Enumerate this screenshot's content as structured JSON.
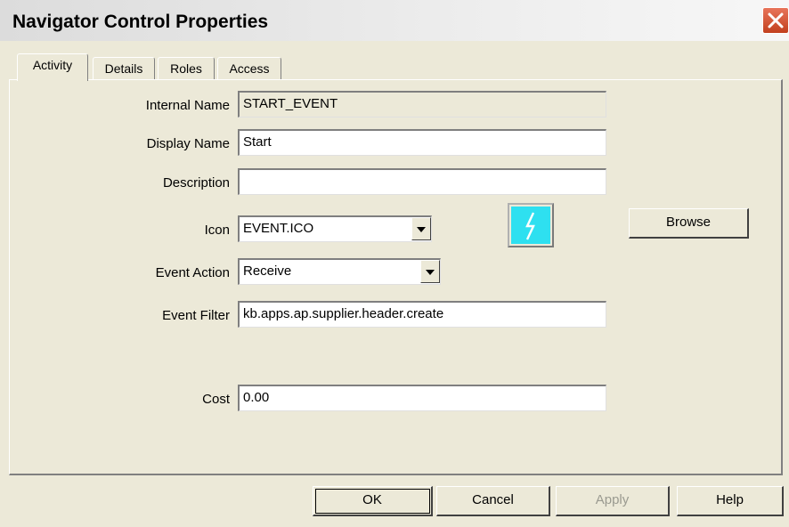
{
  "window": {
    "title": "Navigator Control Properties",
    "close_glyph": "✕"
  },
  "tabs": [
    {
      "label": "Activity",
      "active": true
    },
    {
      "label": "Details",
      "active": false
    },
    {
      "label": "Roles",
      "active": false
    },
    {
      "label": "Access",
      "active": false
    }
  ],
  "form": {
    "internal_name": {
      "label": "Internal Name",
      "value": "START_EVENT"
    },
    "display_name": {
      "label": "Display Name",
      "value": "Start"
    },
    "description": {
      "label": "Description",
      "value": ""
    },
    "icon": {
      "label": "Icon",
      "value": "EVENT.ICO",
      "preview_icon": "lightning-icon"
    },
    "event_action": {
      "label": "Event Action",
      "value": "Receive"
    },
    "event_filter": {
      "label": "Event Filter",
      "value": "kb.apps.ap.supplier.header.create"
    },
    "cost": {
      "label": "Cost",
      "value": "0.00"
    }
  },
  "buttons": {
    "browse": "Browse",
    "ok": "OK",
    "cancel": "Cancel",
    "apply": "Apply",
    "help": "Help"
  },
  "colors": {
    "dialog_bg": "#ece9d8",
    "close_red": "#c2401e",
    "icon_preview_bg": "#2ee0f0"
  }
}
